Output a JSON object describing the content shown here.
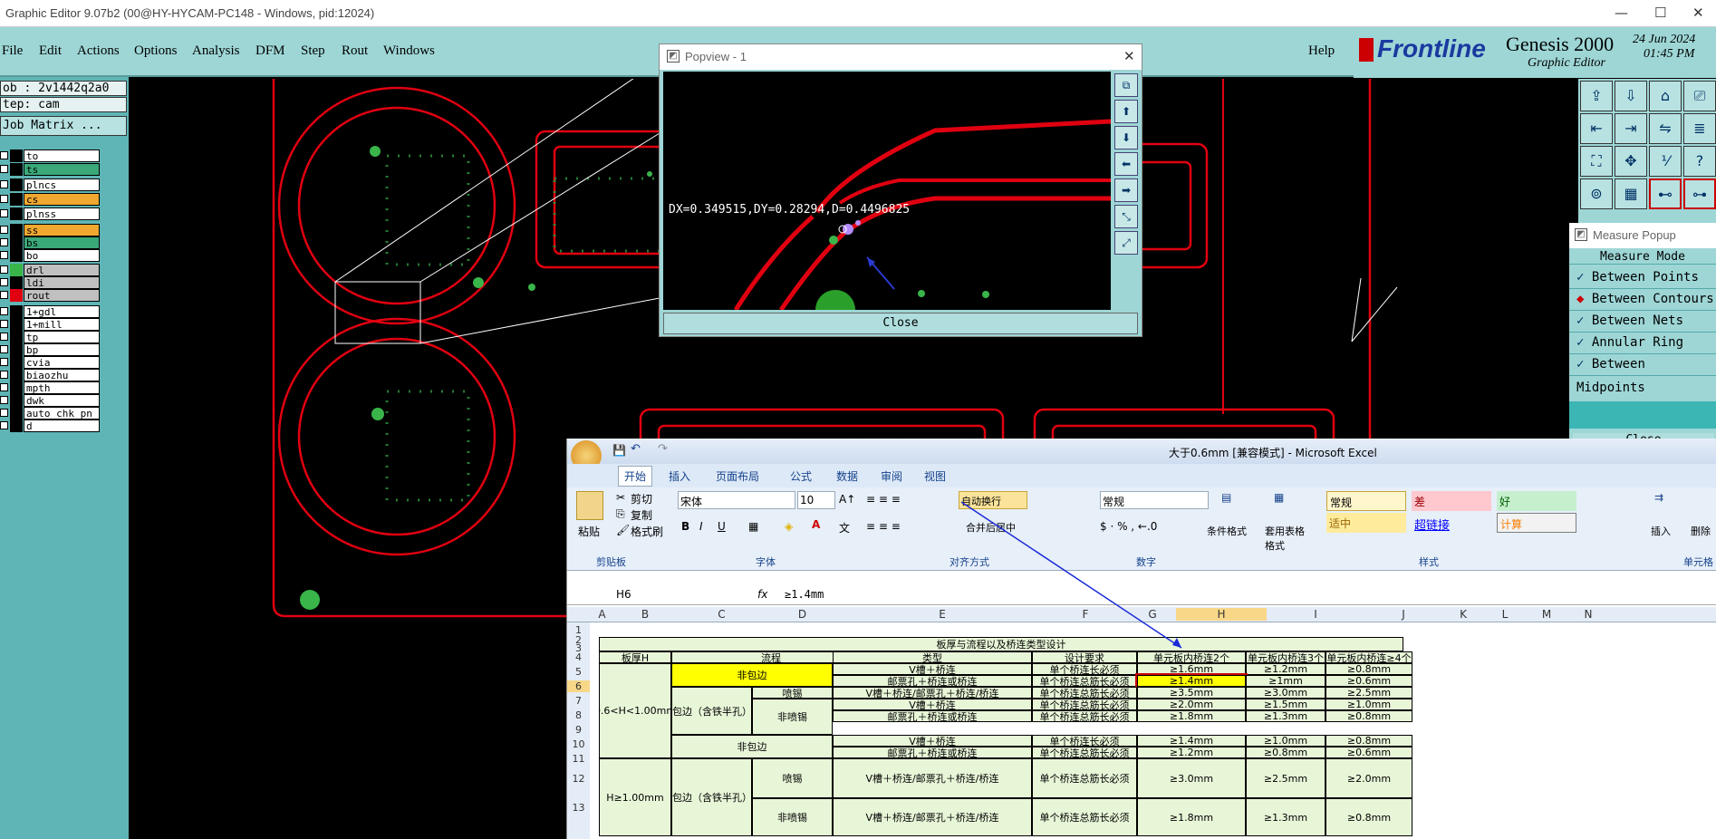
{
  "window": {
    "title": "Graphic Editor 9.07b2 (00@HY-HYCAM-PC148 - Windows, pid:12024)"
  },
  "menu": [
    "File",
    "Edit",
    "Actions",
    "Options",
    "Analysis",
    "DFM",
    "Step",
    "Rout",
    "Windows"
  ],
  "help": "Help",
  "brand": {
    "frontline": "Frontline",
    "genesis": "Genesis 2000",
    "sub": "Graphic Editor",
    "date": "24 Jun 2024",
    "time": "01:45 PM"
  },
  "job": {
    "job": "ob : 2v1442q2a0",
    "step": "tep: cam",
    "matrix": "Job Matrix ..."
  },
  "layers": [
    {
      "name": "to",
      "color": "#ffffff"
    },
    {
      "name": "ts",
      "color": "#3aa878"
    },
    {
      "name": "plncs",
      "color": "#ffffff"
    },
    {
      "name": "cs",
      "color": "#f0a830"
    },
    {
      "name": "plnss",
      "color": "#ffffff"
    },
    {
      "name": "ss",
      "color": "#f0a830"
    },
    {
      "name": "bs",
      "color": "#3aa878"
    },
    {
      "name": "bo",
      "color": "#ffffff"
    },
    {
      "name": "drl",
      "color": "#c0c0c0"
    },
    {
      "name": "ldi",
      "color": "#c0c0c0"
    },
    {
      "name": "rout",
      "color": "#c0c0c0"
    },
    {
      "name": "1+gdl",
      "color": "#ffffff"
    },
    {
      "name": "1+mill",
      "color": "#ffffff"
    },
    {
      "name": "tp",
      "color": "#ffffff"
    },
    {
      "name": "bp",
      "color": "#ffffff"
    },
    {
      "name": "cvia",
      "color": "#ffffff"
    },
    {
      "name": "biaozhu",
      "color": "#ffffff"
    },
    {
      "name": "mpth",
      "color": "#ffffff"
    },
    {
      "name": "dwk",
      "color": "#ffffff"
    },
    {
      "name": "auto_chk_pn",
      "color": "#ffffff"
    },
    {
      "name": "d",
      "color": "#ffffff"
    }
  ],
  "popview": {
    "title": "Popview - 1",
    "measure": "DX=0.349515,DY=0.28294,D=0.4496825",
    "close": "Close"
  },
  "measure": {
    "title": "Measure Popup",
    "mode": "Measure Mode",
    "items": [
      "Between Points",
      "Between Contours",
      "Between Nets",
      "Annular Ring",
      "Between Midpoints"
    ],
    "close": "Close"
  },
  "excel": {
    "title": "大于0.6mm  [兼容模式] - Microsoft Excel",
    "tabs": [
      "开始",
      "插入",
      "页面布局",
      "公式",
      "数据",
      "审阅",
      "视图"
    ],
    "clipboard": {
      "paste": "粘贴",
      "cut": "剪切",
      "copy": "复制",
      "format": "格式刷",
      "group": "剪贴板"
    },
    "font": {
      "name": "宋体",
      "size": "10",
      "group": "字体"
    },
    "align": {
      "wrap": "自动换行",
      "merge": "合并后居中",
      "group": "对齐方式"
    },
    "number": {
      "format": "常规",
      "group": "数字"
    },
    "styles": {
      "cond": "条件格式",
      "table": "套用表格格式",
      "normal": "常规",
      "bad": "差",
      "good": "好",
      "neutral": "适中",
      "link": "超链接",
      "calc": "计算",
      "group": "样式"
    },
    "cells": {
      "insert": "插入",
      "delete": "删除",
      "group": "单元格"
    },
    "cellref": "H6",
    "formula": "≥1.4mm",
    "columns": [
      "A",
      "B",
      "C",
      "D",
      "E",
      "F",
      "G",
      "H",
      "I",
      "J",
      "K",
      "L",
      "M",
      "N"
    ],
    "rows": [
      "1",
      "2",
      "3",
      "4",
      "5",
      "6",
      "7",
      "8",
      "9",
      "10",
      "11",
      "12",
      "13"
    ],
    "table": {
      "title": "板厚与流程以及桥连类型设计",
      "headers": [
        "板厚H",
        "流程",
        "类型",
        "设计要求",
        "单元板内桥连2个",
        "单元板内桥连3个",
        "单元板内桥连≥4个"
      ],
      "thick1": "0.6<H<1.00mm",
      "thick2": "H≥1.00mm",
      "nobag": "非包边",
      "bag": "包边（含铁半孔）",
      "spray": "喷锡",
      "nospray": "非喷锡",
      "r5": [
        "V槽＋桥连",
        "单个桥连长必须",
        "≥1.6mm",
        "≥1.2mm",
        "≥0.8mm"
      ],
      "r6": [
        "邮票孔＋桥连或桥连",
        "单个桥连总筋长必须",
        "≥1.4mm",
        "≥1mm",
        "≥0.6mm"
      ],
      "r7": [
        "V槽＋桥连/邮票孔＋桥连/桥连",
        "单个桥连总筋长必须",
        "≥3.5mm",
        "≥3.0mm",
        "≥2.5mm"
      ],
      "r8": [
        "V槽＋桥连",
        "单个桥连总筋长必须",
        "≥2.0mm",
        "≥1.5mm",
        "≥1.0mm"
      ],
      "r9": [
        "邮票孔＋桥连或桥连",
        "单个桥连总筋长必须",
        "≥1.8mm",
        "≥1.3mm",
        "≥0.8mm"
      ],
      "r10": [
        "V槽＋桥连",
        "单个桥连长必须",
        "≥1.4mm",
        "≥1.0mm",
        "≥0.8mm"
      ],
      "r11": [
        "邮票孔＋桥连或桥连",
        "单个桥连总筋长必须",
        "≥1.2mm",
        "≥0.8mm",
        "≥0.6mm"
      ],
      "r12": [
        "V槽＋桥连/邮票孔＋桥连/桥连",
        "单个桥连总筋长必须",
        "≥3.0mm",
        "≥2.5mm",
        "≥2.0mm"
      ],
      "r13": [
        "V槽＋桥连/邮票孔＋桥连/桥连",
        "单个桥连总筋长必须",
        "≥1.8mm",
        "≥1.3mm",
        "≥0.8mm"
      ]
    }
  }
}
